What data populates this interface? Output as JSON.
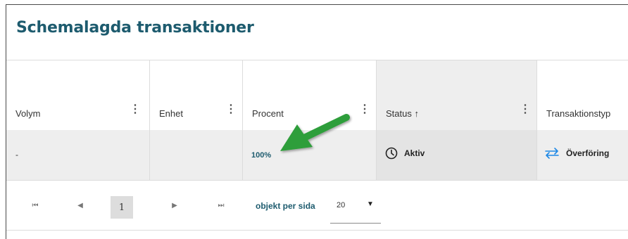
{
  "title": "Schemalagda transaktioner",
  "columns": [
    {
      "label": "Volym",
      "menu_icon": "⋮"
    },
    {
      "label": "Enhet",
      "menu_icon": "⋮"
    },
    {
      "label": "Procent",
      "menu_icon": "⋮"
    },
    {
      "label": "Status ↑",
      "menu_icon": "⋮"
    },
    {
      "label": "Transaktionstyp"
    }
  ],
  "row": {
    "volym": "-",
    "enhet": "",
    "procent": "100%",
    "status": "Aktiv",
    "status_icon": "clock-icon",
    "transaktionstyp": "Överföring",
    "type_icon": "transfer-arrows-icon"
  },
  "pagination": {
    "first": "⏮",
    "prev": "◀",
    "current_page": "1",
    "next": "▶",
    "last": "⏭",
    "per_page_label": "objekt per sida",
    "per_page_value": "20",
    "caret": "▼"
  },
  "colors": {
    "title": "#1d5b6e",
    "accent": "#1d5b6e",
    "arrow": "#2e9e3a",
    "row_bg": "#eeeeee"
  },
  "annotation": {
    "type": "green-arrow",
    "points_to": "procent-cell"
  }
}
